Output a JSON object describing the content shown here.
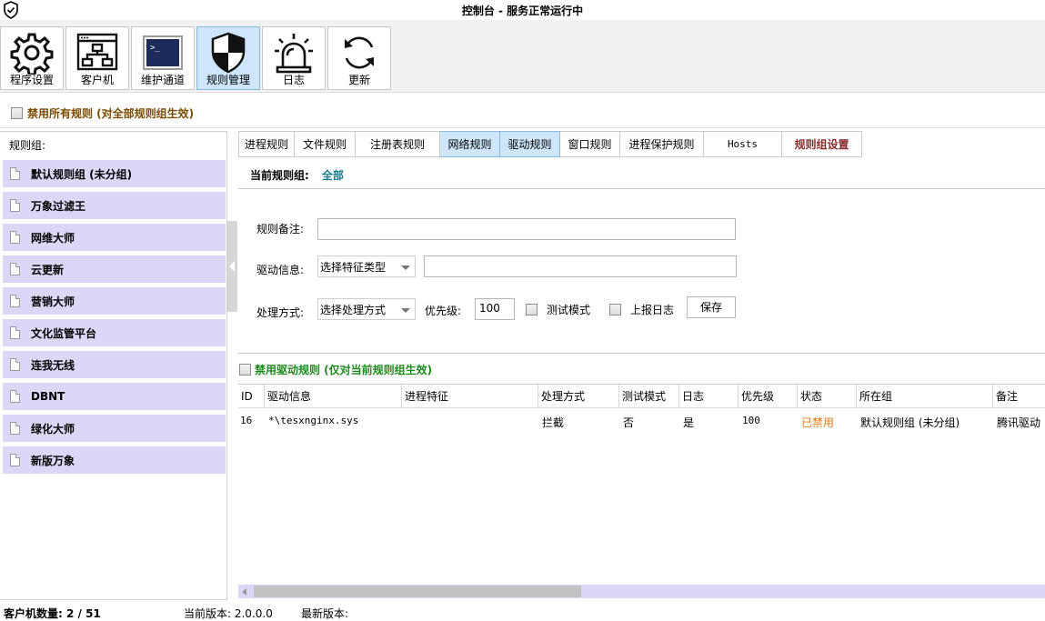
{
  "window": {
    "title": "控制台 - 服务正常运行中"
  },
  "toolbar": {
    "items": [
      {
        "label": "程序设置",
        "icon": "gear-icon"
      },
      {
        "label": "客户机",
        "icon": "network-icon"
      },
      {
        "label": "维护通道",
        "icon": "terminal-icon"
      },
      {
        "label": "规则管理",
        "icon": "shield-icon",
        "active": true
      },
      {
        "label": "日志",
        "icon": "alarm-light-icon"
      },
      {
        "label": "更新",
        "icon": "refresh-icon"
      }
    ]
  },
  "disable_all": {
    "label": "禁用所有规则 (对全部规则组生效)",
    "checked": false
  },
  "sidebar": {
    "header": "规则组:",
    "groups": [
      {
        "name": "默认规则组 (未分组)"
      },
      {
        "name": "万象过滤王"
      },
      {
        "name": "网维大师"
      },
      {
        "name": "云更新"
      },
      {
        "name": "营销大师"
      },
      {
        "name": "文化监管平台"
      },
      {
        "name": "连我无线"
      },
      {
        "name": "DBNT"
      },
      {
        "name": "绿化大师"
      },
      {
        "name": "新版万象"
      }
    ]
  },
  "tabs": [
    {
      "label": "进程规则"
    },
    {
      "label": "文件规则"
    },
    {
      "label": "注册表规则"
    },
    {
      "label": "网络规则",
      "selected": true
    },
    {
      "label": "驱动规则",
      "selected": true
    },
    {
      "label": "窗口规则"
    },
    {
      "label": "进程保护规则"
    },
    {
      "label": "Hosts"
    },
    {
      "label": "规则组设置"
    }
  ],
  "current_group": {
    "label": "当前规则组:",
    "value": "全部"
  },
  "form": {
    "note_label": "规则备注:",
    "note_value": "",
    "driver_label": "驱动信息:",
    "driver_select": "选择特征类型",
    "driver_value": "",
    "action_label": "处理方式:",
    "action_select": "选择处理方式",
    "priority_label": "优先级:",
    "priority_value": "100",
    "test_mode_label": "测试模式",
    "report_log_label": "上报日志",
    "save_label": "保存"
  },
  "disable_driver": {
    "label": "禁用驱动规则 (仅对当前规则组生效)",
    "checked": false
  },
  "table": {
    "columns": [
      "ID",
      "驱动信息",
      "进程特征",
      "处理方式",
      "测试模式",
      "日志",
      "优先级",
      "状态",
      "所在组",
      "备注"
    ],
    "rows": [
      [
        "16",
        "*\\tesxnginx.sys",
        "",
        "拦截",
        "否",
        "是",
        "100",
        "已禁用",
        "默认规则组 (未分组)",
        "腾讯驱动"
      ]
    ]
  },
  "statusbar": {
    "clients": "客户机数量: 2 / 51",
    "current_version": "当前版本: 2.0.0.0",
    "latest_version": "最新版本:"
  },
  "colors": {
    "selected": "#cde6fb",
    "group_bg": "#dad7f7",
    "status_disabled": "#e07a10",
    "disable_all_text": "#7a4b00",
    "disable_driver_text": "#1c8a1c",
    "current_group_value": "#1a7a8c"
  }
}
